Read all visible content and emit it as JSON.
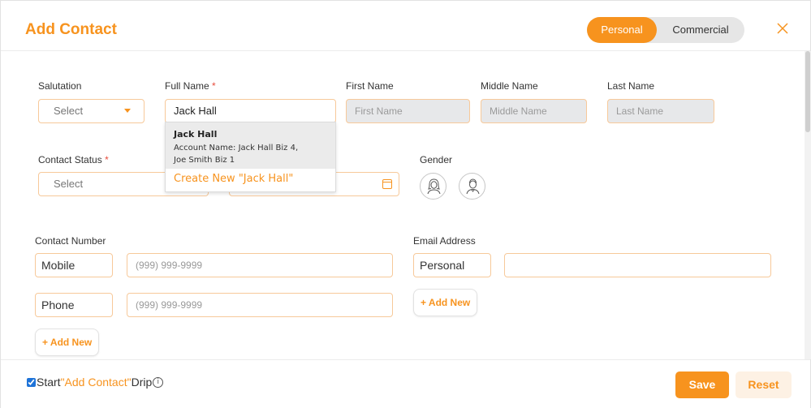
{
  "header": {
    "title": "Add Contact",
    "toggle": {
      "personal": "Personal",
      "commercial": "Commercial",
      "active": "Personal"
    }
  },
  "form": {
    "salutation": {
      "label": "Salutation",
      "value": "Select"
    },
    "full_name": {
      "label": "Full Name",
      "required": "*",
      "value": "Jack Hall"
    },
    "first_name": {
      "label": "First Name",
      "placeholder": "First Name"
    },
    "middle_name": {
      "label": "Middle Name",
      "placeholder": "Middle Name"
    },
    "last_name": {
      "label": "Last Name",
      "placeholder": "Last Name"
    },
    "contact_status": {
      "label": "Contact Status",
      "required": "*",
      "value": "Select"
    },
    "gender": {
      "label": "Gender"
    },
    "contact_number": {
      "label": "Contact Number",
      "rows": [
        {
          "type": "Mobile",
          "placeholder": "(999) 999-9999"
        },
        {
          "type": "Phone",
          "placeholder": "(999) 999-9999"
        }
      ],
      "add_label": "+ Add New"
    },
    "email_address": {
      "label": "Email Address",
      "rows": [
        {
          "type": "Personal",
          "value": ""
        }
      ],
      "add_label": "+ Add New"
    }
  },
  "dropdown": {
    "item_name": "Jack Hall",
    "item_account_line1": "Account Name: Jack Hall Biz 4,",
    "item_account_line2": "Joe Smith Biz 1",
    "create_label": "Create New \"Jack Hall\""
  },
  "footer": {
    "drip_prefix": "Start",
    "drip_highlight": "\"Add Contact\"",
    "drip_suffix": "Drip",
    "drip_checked": true,
    "info_glyph": "i",
    "save_label": "Save",
    "reset_label": "Reset"
  },
  "colors": {
    "accent": "#f7931e",
    "accent_light": "#fdf1e4",
    "field_border": "#f7c99a",
    "disabled_bg": "#e7e8ea"
  }
}
